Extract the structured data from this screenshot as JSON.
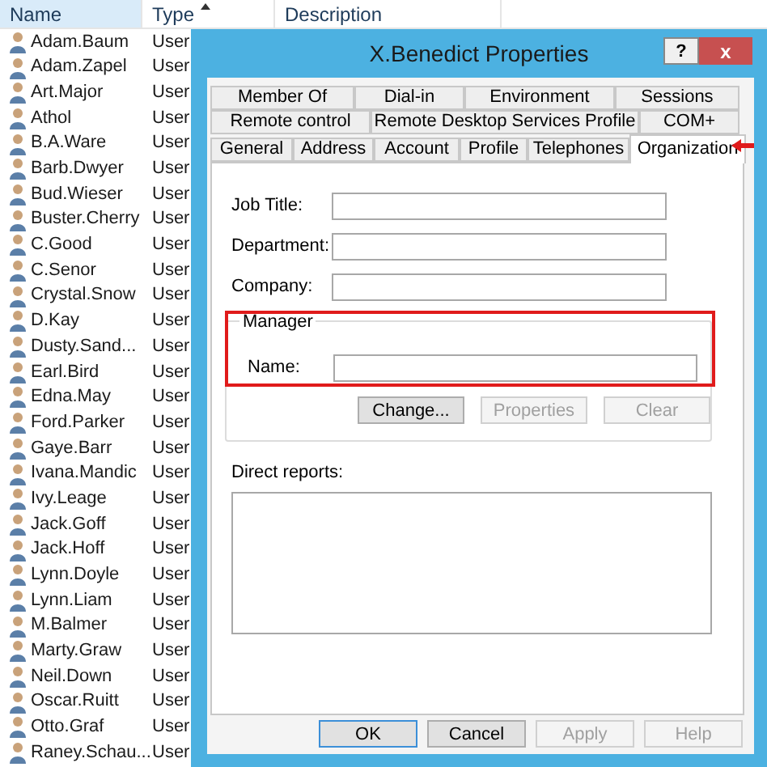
{
  "list": {
    "columns": [
      {
        "label": "Name",
        "selected": true
      },
      {
        "label": "Type",
        "selected": false
      },
      {
        "label": "Description",
        "selected": false
      }
    ],
    "rows": [
      {
        "name": "Adam.Baum",
        "type": "User"
      },
      {
        "name": "Adam.Zapel",
        "type": "User"
      },
      {
        "name": "Art.Major",
        "type": "User"
      },
      {
        "name": "Athol",
        "type": "User"
      },
      {
        "name": "B.A.Ware",
        "type": "User"
      },
      {
        "name": "Barb.Dwyer",
        "type": "User"
      },
      {
        "name": "Bud.Wieser",
        "type": "User"
      },
      {
        "name": "Buster.Cherry",
        "type": "User"
      },
      {
        "name": "C.Good",
        "type": "User"
      },
      {
        "name": "C.Senor",
        "type": "User"
      },
      {
        "name": "Crystal.Snow",
        "type": "User"
      },
      {
        "name": "D.Kay",
        "type": "User"
      },
      {
        "name": "Dusty.Sand...",
        "type": "User"
      },
      {
        "name": "Earl.Bird",
        "type": "User"
      },
      {
        "name": "Edna.May",
        "type": "User"
      },
      {
        "name": "Ford.Parker",
        "type": "User"
      },
      {
        "name": "Gaye.Barr",
        "type": "User"
      },
      {
        "name": "Ivana.Mandic",
        "type": "User"
      },
      {
        "name": "Ivy.Leage",
        "type": "User"
      },
      {
        "name": "Jack.Goff",
        "type": "User"
      },
      {
        "name": "Jack.Hoff",
        "type": "User"
      },
      {
        "name": "Lynn.Doyle",
        "type": "User"
      },
      {
        "name": "Lynn.Liam",
        "type": "User"
      },
      {
        "name": "M.Balmer",
        "type": "User"
      },
      {
        "name": "Marty.Graw",
        "type": "User"
      },
      {
        "name": "Neil.Down",
        "type": "User"
      },
      {
        "name": "Oscar.Ruitt",
        "type": "User"
      },
      {
        "name": "Otto.Graf",
        "type": "User"
      },
      {
        "name": "Raney.Schau...",
        "type": "User"
      }
    ]
  },
  "dialog": {
    "title": "X.Benedict Properties",
    "help_button": "?",
    "close_button": "x",
    "tab_rows": [
      [
        {
          "label": "Member Of",
          "selected": false
        },
        {
          "label": "Dial-in",
          "selected": false
        },
        {
          "label": "Environment",
          "selected": false
        },
        {
          "label": "Sessions",
          "selected": false
        }
      ],
      [
        {
          "label": "Remote control",
          "selected": false
        },
        {
          "label": "Remote Desktop Services Profile",
          "selected": false
        },
        {
          "label": "COM+",
          "selected": false
        }
      ],
      [
        {
          "label": "General",
          "selected": false
        },
        {
          "label": "Address",
          "selected": false
        },
        {
          "label": "Account",
          "selected": false
        },
        {
          "label": "Profile",
          "selected": false
        },
        {
          "label": "Telephones",
          "selected": false
        },
        {
          "label": "Organization",
          "selected": true
        }
      ]
    ],
    "fields": [
      {
        "label": "Job Title:"
      },
      {
        "label": "Department:"
      },
      {
        "label": "Company:"
      }
    ],
    "manager": {
      "title": "Manager",
      "name_label": "Name:",
      "buttons": [
        {
          "label": "Change...",
          "disabled": false
        },
        {
          "label": "Properties",
          "disabled": true
        },
        {
          "label": "Clear",
          "disabled": true
        }
      ]
    },
    "direct_reports_label": "Direct reports:",
    "buttons": [
      {
        "label": "OK",
        "disabled": false,
        "default": true
      },
      {
        "label": "Cancel",
        "disabled": false,
        "default": false
      },
      {
        "label": "Apply",
        "disabled": true,
        "default": false
      },
      {
        "label": "Help",
        "disabled": true,
        "default": false
      }
    ]
  }
}
